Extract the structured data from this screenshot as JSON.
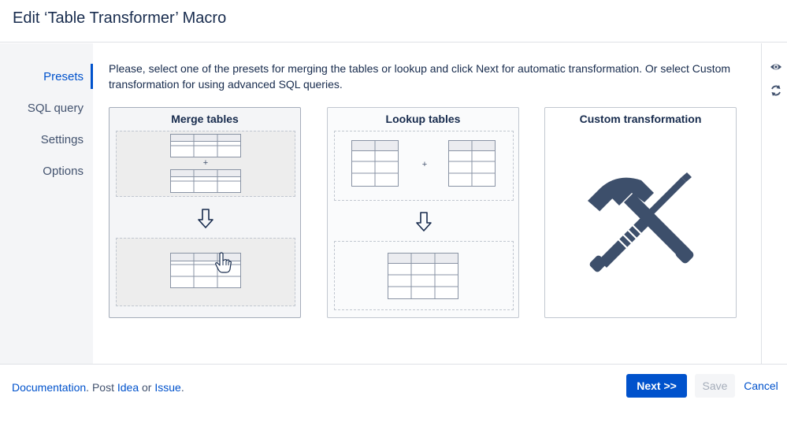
{
  "dialog": {
    "title": "Edit ‘Table Transformer’ Macro"
  },
  "nav": {
    "items": [
      {
        "label": "Presets",
        "active": true
      },
      {
        "label": "SQL query",
        "active": false
      },
      {
        "label": "Settings",
        "active": false
      },
      {
        "label": "Options",
        "active": false
      }
    ]
  },
  "content": {
    "intro": "Please, select one of the presets for merging the tables or lookup and click Next for automatic transformation. Or select Custom transformation for using advanced SQL queries.",
    "presets": [
      {
        "title": "Merge tables",
        "plus": "+"
      },
      {
        "title": "Lookup tables",
        "plus": "+"
      },
      {
        "title": "Custom transformation"
      }
    ]
  },
  "rail": {
    "icons": [
      "eye-icon",
      "refresh-icon"
    ]
  },
  "footer": {
    "documentation": "Documentation",
    "post_text": ". Post ",
    "idea": "Idea",
    "or_text": " or ",
    "issue": "Issue",
    "period": ".",
    "next_label": "Next >>",
    "save_label": "Save",
    "cancel_label": "Cancel"
  },
  "colors": {
    "primary": "#0052cc",
    "text": "#172b4d",
    "icon": "#3d4f6b"
  }
}
